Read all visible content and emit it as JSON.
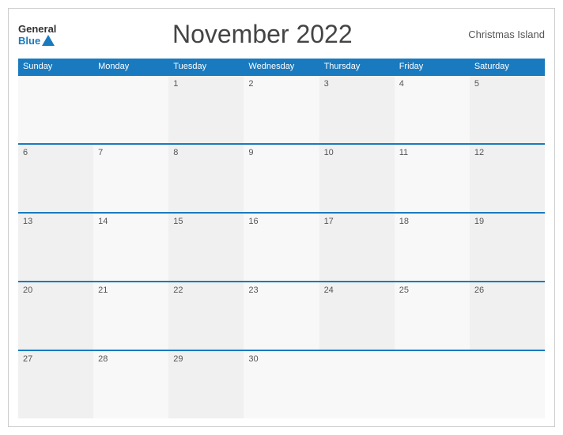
{
  "header": {
    "logo_general": "General",
    "logo_blue": "Blue",
    "title": "November 2022",
    "region": "Christmas Island"
  },
  "days": {
    "headers": [
      "Sunday",
      "Monday",
      "Tuesday",
      "Wednesday",
      "Thursday",
      "Friday",
      "Saturday"
    ]
  },
  "weeks": [
    [
      "",
      "",
      "1",
      "2",
      "3",
      "4",
      "5"
    ],
    [
      "6",
      "7",
      "8",
      "9",
      "10",
      "11",
      "12"
    ],
    [
      "13",
      "14",
      "15",
      "16",
      "17",
      "18",
      "19"
    ],
    [
      "20",
      "21",
      "22",
      "23",
      "24",
      "25",
      "26"
    ],
    [
      "27",
      "28",
      "29",
      "30",
      "",
      "",
      ""
    ]
  ]
}
